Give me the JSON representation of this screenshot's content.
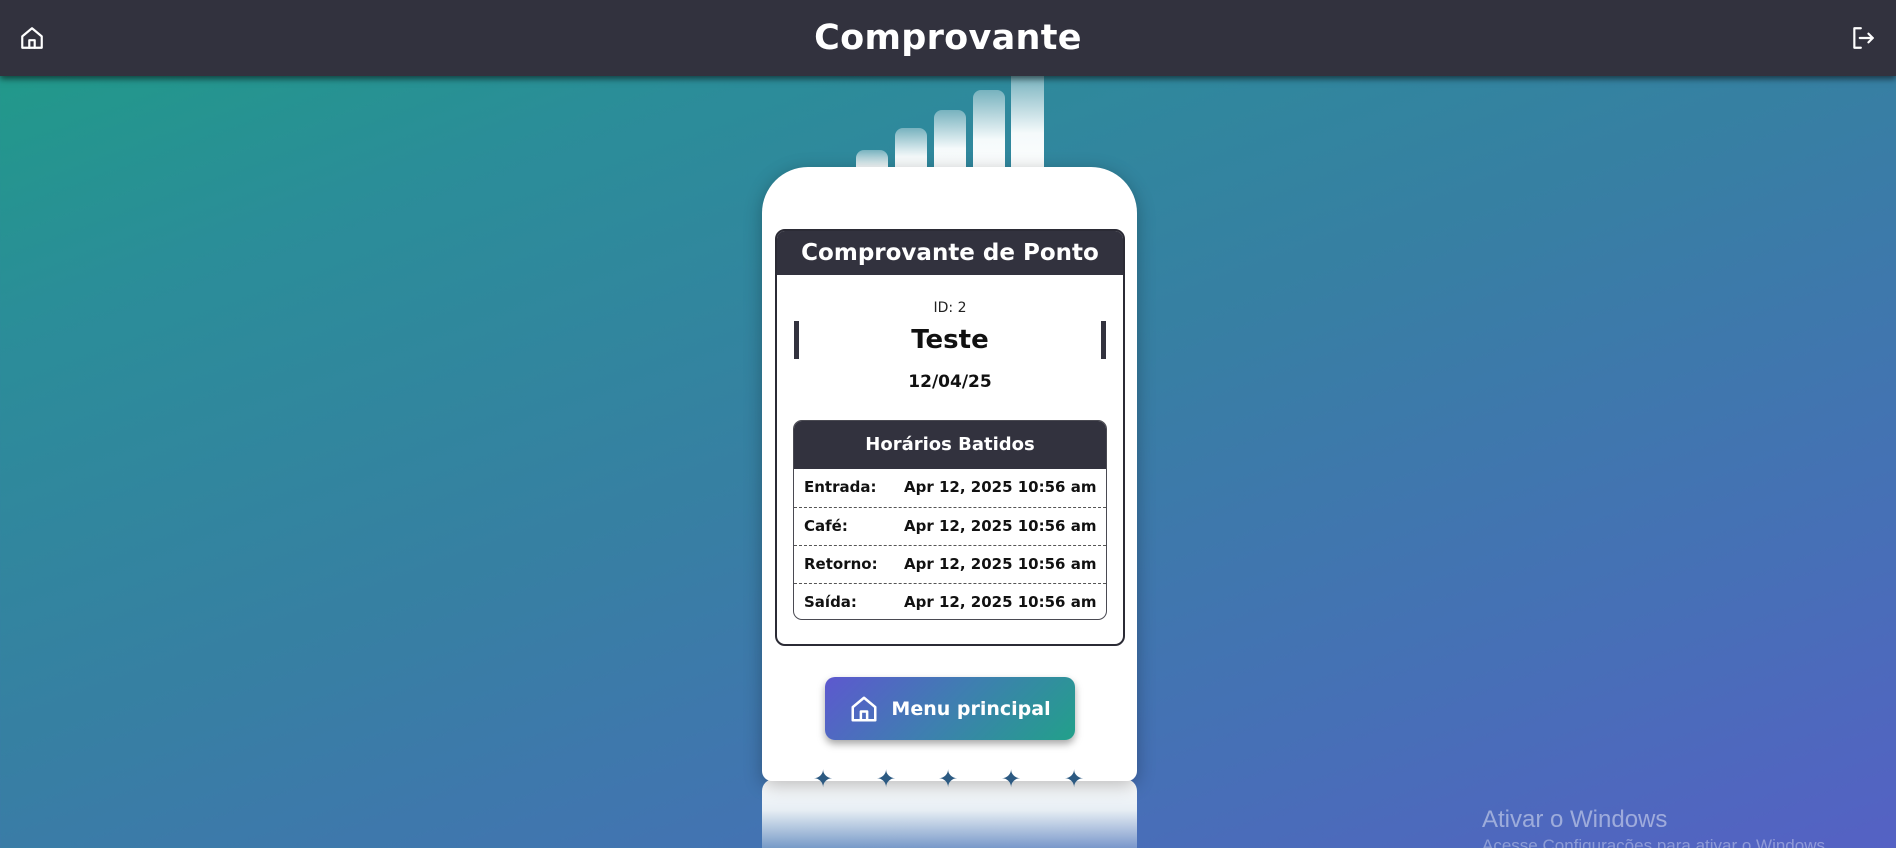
{
  "header": {
    "title": "Comprovante",
    "home_icon": "home-icon",
    "logout_icon": "logout-icon"
  },
  "receipt": {
    "title": "Comprovante de Ponto",
    "id_text": "ID: 2",
    "name": "Teste",
    "date": "12/04/25",
    "times_title": "Horários Batidos",
    "rows": [
      {
        "label": "Entrada:",
        "value": "Apr 12, 2025 10:56 am"
      },
      {
        "label": "Café:",
        "value": "Apr 12, 2025 10:56 am"
      },
      {
        "label": "Retorno:",
        "value": "Apr 12, 2025 10:56 am"
      },
      {
        "label": "Saída:",
        "value": "Apr 12, 2025 10:56 am"
      }
    ]
  },
  "menu_button": {
    "label": "Menu principal",
    "icon": "home-icon"
  },
  "decor": {
    "star_glyph": "✦",
    "colors": {
      "topbar": "#32323e",
      "star": "#2c5a82"
    }
  },
  "watermark": {
    "title": "Ativar o Windows",
    "subtitle": "Acesse Configurações para ativar o Windows."
  }
}
